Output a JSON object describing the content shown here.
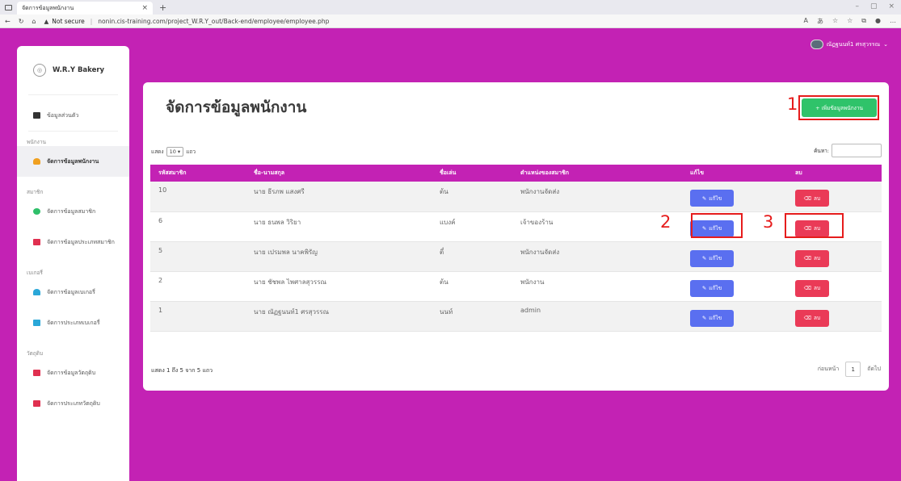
{
  "browser": {
    "tab_title": "จัดการข้อมูลพนักงาน",
    "tab_close": "×",
    "new_tab": "+",
    "not_secure": "Not secure",
    "url": "nonin.cis-training.com/project_W.R.Y_out/Back-end/employee/employee.php",
    "window_controls": [
      "–",
      "▢",
      "×"
    ]
  },
  "sidebar": {
    "brand": "W.R.Y Bakery",
    "profile_item": "ข้อมูลส่วนตัว",
    "groups": [
      {
        "label": "พนักงาน",
        "items": [
          {
            "label": "จัดการข้อมูลพนักงาน",
            "icon": "user-icon",
            "color": "#f0a020",
            "active": true
          }
        ]
      },
      {
        "label": "สมาชิก",
        "items": [
          {
            "label": "จัดการข้อมูลสมาชิก",
            "icon": "users-icon",
            "color": "#2fbf6a"
          },
          {
            "label": "จัดการข้อมูลประเภทสมาชิก",
            "icon": "book-icon",
            "color": "#e03050"
          }
        ]
      },
      {
        "label": "เบเกอรี่",
        "items": [
          {
            "label": "จัดการข้อมูลเบเกอรี่",
            "icon": "cake-icon",
            "color": "#2aa7d8"
          },
          {
            "label": "จัดการประเภทเบเกอรี่",
            "icon": "book-icon",
            "color": "#2aa7d8"
          }
        ]
      },
      {
        "label": "วัตถุดิบ",
        "items": [
          {
            "label": "จัดการข้อมูลวัตถุดิบ",
            "icon": "box-icon",
            "color": "#e03050"
          },
          {
            "label": "จัดการประเภทวัตถุดิบ",
            "icon": "book-icon",
            "color": "#e03050"
          }
        ]
      }
    ]
  },
  "user": {
    "name": "ณัฏฐนนท์1 ศรสุวรรณ",
    "caret": "⌄"
  },
  "main": {
    "title": "จัดการข้อมูลพนักงาน",
    "add_button": "+ เพิ่มข้อมูลพนักงาน",
    "show_prefix": "แสดง",
    "page_size": "10",
    "show_suffix": "แถว",
    "search_label": "ค้นหา:",
    "columns": [
      "รหัสสมาชิก",
      "ชื่อ-นามสกุล",
      "ชื่อเล่น",
      "ตำแหน่งของสมาชิก",
      "แก้ไข",
      "ลบ"
    ],
    "rows": [
      [
        "10",
        "นาย ธีรภพ แสงศรี",
        "ต้น",
        "พนักงานจัดส่ง"
      ],
      [
        "6",
        "นาย ธนพล วิริยา",
        "แบงค์",
        "เจ้าของร้าน"
      ],
      [
        "5",
        "นาย เปรมพล นาคพิรัญ",
        "ตี๋",
        "พนักงานจัดส่ง"
      ],
      [
        "2",
        "นาย ชัชพล ไพศาลสุวรรณ",
        "ต้น",
        "พนักงาน"
      ],
      [
        "1",
        "นาย ณัฏฐนนท์1 ศรสุวรรณ",
        "นนท์",
        "admin"
      ]
    ],
    "edit_label": "แก้ไข",
    "delete_label": "ลบ",
    "info": "แสดง 1 ถึง 5 จาก 5 แถว",
    "prev": "ก่อนหน้า",
    "page": "1",
    "next": "ถัดไป"
  },
  "annotations": [
    "1",
    "2",
    "3"
  ],
  "colors": {
    "primary": "#c322b4",
    "success": "#2fc36a",
    "edit": "#5a6ff0",
    "delete": "#ea3a57",
    "highlight": "#e61c1c"
  }
}
